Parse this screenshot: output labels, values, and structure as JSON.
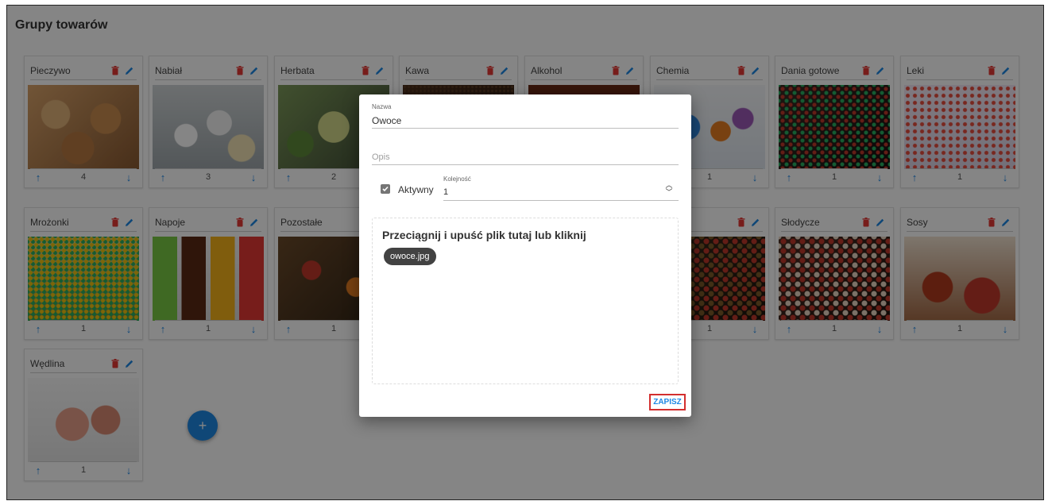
{
  "page": {
    "title": "Grupy towarów"
  },
  "colors": {
    "accent": "#1e88e5",
    "delete": "#e53935",
    "highlight": "#d32f2f"
  },
  "icons": {
    "delete": "trash-icon",
    "edit": "pencil-icon",
    "move_up": "arrow-up-icon",
    "move_down": "arrow-down-icon",
    "add": "plus-icon"
  },
  "groups": [
    {
      "name": "Pieczywo",
      "order": "4"
    },
    {
      "name": "Nabiał",
      "order": "3"
    },
    {
      "name": "Herbata",
      "order": "2"
    },
    {
      "name": "Kawa",
      "order": ""
    },
    {
      "name": "Alkohol",
      "order": ""
    },
    {
      "name": "Chemia",
      "order": "1"
    },
    {
      "name": "Dania gotowe",
      "order": "1"
    },
    {
      "name": "Leki",
      "order": "1"
    },
    {
      "name": "Mrożonki",
      "order": "1"
    },
    {
      "name": "Napoje",
      "order": "1"
    },
    {
      "name": "Pozostałe",
      "order": "1"
    },
    {
      "name": "",
      "order": ""
    },
    {
      "name": "",
      "order": ""
    },
    {
      "name": "",
      "order": "1"
    },
    {
      "name": "Słodycze",
      "order": "1"
    },
    {
      "name": "Sosy",
      "order": "1"
    },
    {
      "name": "Wędlina",
      "order": "1"
    }
  ],
  "add_button": {
    "label": "+"
  },
  "dialog": {
    "name_label": "Nazwa",
    "name_value": "Owoce",
    "description_placeholder": "Opis",
    "active_label": "Aktywny",
    "active_checked": true,
    "order_label": "Kolejność",
    "order_value": "1",
    "dropzone_text": "Przeciągnij i upuść plik tutaj lub kliknij",
    "file_chip": "owoce.jpg",
    "save_label": "ZAPISZ"
  }
}
